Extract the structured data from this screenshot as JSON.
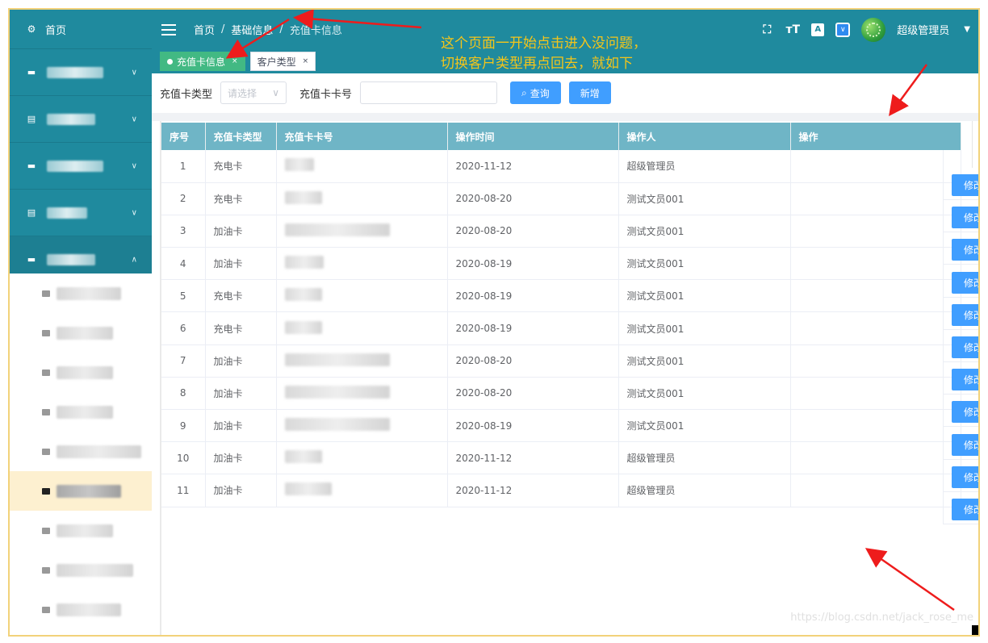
{
  "sidebar": {
    "home_label": "首页",
    "groups": [
      {
        "id": "g1",
        "state": "collapsed"
      },
      {
        "id": "g2",
        "state": "collapsed"
      },
      {
        "id": "g3",
        "state": "collapsed"
      },
      {
        "id": "g4",
        "state": "collapsed"
      },
      {
        "id": "g5",
        "state": "expanded"
      }
    ],
    "sub_items": [
      {
        "state": "normal"
      },
      {
        "state": "normal"
      },
      {
        "state": "normal"
      },
      {
        "state": "normal"
      },
      {
        "state": "normal"
      },
      {
        "state": "active"
      },
      {
        "state": "normal"
      },
      {
        "state": "normal"
      },
      {
        "state": "normal"
      }
    ]
  },
  "header": {
    "breadcrumb": [
      "首页",
      "基础信息",
      "充值卡信息"
    ],
    "separator": "/",
    "lang_icon": "A",
    "user_name": "超级管理员"
  },
  "tabs": [
    {
      "label": "充值卡信息",
      "active": true,
      "close": "×"
    },
    {
      "label": "客户类型",
      "active": false,
      "close": "×"
    }
  ],
  "annotation": {
    "line1": "这个页面一开始点击进入没问题，",
    "line2": "切换客户类型再点回去，就如下",
    "color": "#f4c51a",
    "arrow_color": "#ee1c1c"
  },
  "filter": {
    "type_label": "充值卡类型",
    "type_placeholder": "请选择",
    "number_label": "充值卡卡号",
    "number_value": "",
    "search_label": "查询",
    "add_label": "新增"
  },
  "table": {
    "headers": [
      "序号",
      "充值卡类型",
      "充值卡卡号",
      "操作时间",
      "操作人",
      "操作"
    ],
    "rows": [
      {
        "idx": "1",
        "type": "充电卡",
        "time": "2020-11-12",
        "operator": "超级管理员"
      },
      {
        "idx": "2",
        "type": "充电卡",
        "time": "2020-08-20",
        "operator": "测试文员001"
      },
      {
        "idx": "3",
        "type": "加油卡",
        "time": "2020-08-20",
        "operator": "测试文员001"
      },
      {
        "idx": "4",
        "type": "加油卡",
        "time": "2020-08-19",
        "operator": "测试文员001"
      },
      {
        "idx": "5",
        "type": "充电卡",
        "time": "2020-08-19",
        "operator": "测试文员001"
      },
      {
        "idx": "6",
        "type": "充电卡",
        "time": "2020-08-19",
        "operator": "测试文员001"
      },
      {
        "idx": "7",
        "type": "加油卡",
        "time": "2020-08-20",
        "operator": "测试文员001"
      },
      {
        "idx": "8",
        "type": "加油卡",
        "time": "2020-08-20",
        "operator": "测试文员001"
      },
      {
        "idx": "9",
        "type": "加油卡",
        "time": "2020-08-19",
        "operator": "测试文员001"
      },
      {
        "idx": "10",
        "type": "加油卡",
        "time": "2020-11-12",
        "operator": "超级管理员"
      },
      {
        "idx": "11",
        "type": "加油卡",
        "time": "2020-11-12",
        "operator": "超级管理员"
      }
    ],
    "edit_label": "修改",
    "edit_count": 11
  },
  "watermark": "https://blog.csdn.net/jack_rose_me",
  "colors": {
    "primary": "#1f8a9e",
    "header_row": "#6fb5c6",
    "button": "#409eff",
    "active_tab": "#42b983",
    "active_menu_bg": "#fdf0d0"
  }
}
